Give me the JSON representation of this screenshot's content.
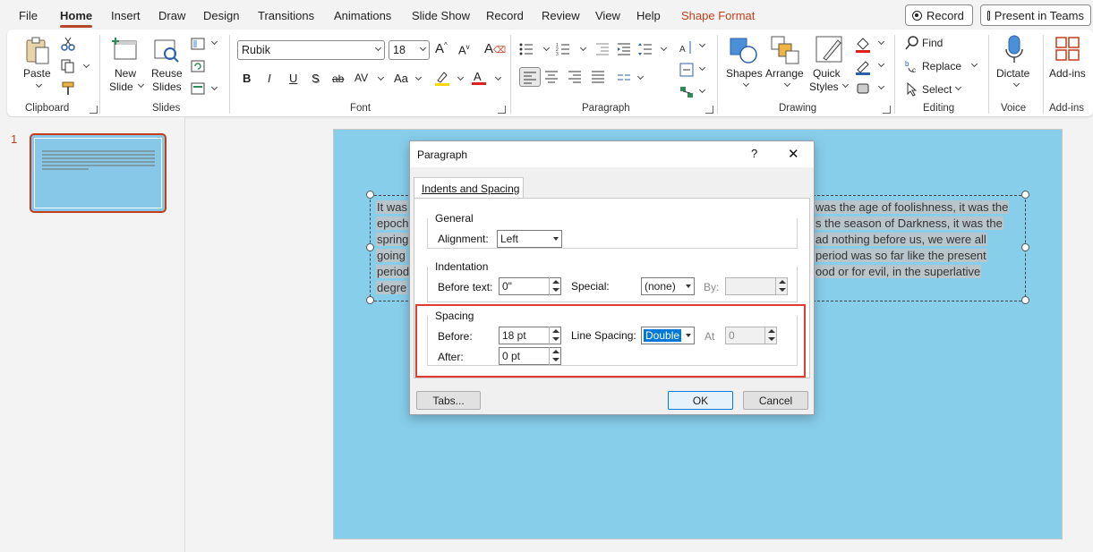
{
  "menu": {
    "items": [
      "File",
      "Home",
      "Insert",
      "Draw",
      "Design",
      "Transitions",
      "Animations",
      "Slide Show",
      "Record",
      "Review",
      "View",
      "Help",
      "Shape Format"
    ],
    "record_button": "Record",
    "present_button": "Present in Teams"
  },
  "ribbon": {
    "clipboard": {
      "paste": "Paste",
      "label": "Clipboard"
    },
    "slides": {
      "new_slide_line1": "New",
      "new_slide_line2": "Slide",
      "reuse_line1": "Reuse",
      "reuse_line2": "Slides",
      "label": "Slides"
    },
    "font": {
      "name": "Rubik",
      "size": "18",
      "bold": "B",
      "italic": "I",
      "underline": "U",
      "shadow": "S",
      "strike": "ab",
      "spacing": "AV",
      "case": "Aa",
      "label": "Font"
    },
    "paragraph": {
      "label": "Paragraph"
    },
    "drawing": {
      "shapes": "Shapes",
      "arrange": "Arrange",
      "quick_line1": "Quick",
      "quick_line2": "Styles",
      "label": "Drawing"
    },
    "editing": {
      "find": "Find",
      "replace": "Replace",
      "select": "Select",
      "label": "Editing"
    },
    "voice": {
      "dictate": "Dictate",
      "label": "Voice"
    },
    "addins": {
      "addins": "Add-ins",
      "label": "Add-ins"
    }
  },
  "thumbnail": {
    "number": "1"
  },
  "slide": {
    "left_lines": [
      "It was",
      "epoch",
      "spring",
      "going",
      "period",
      "degre"
    ],
    "right_lines": [
      "was the age of foolishness, it was the",
      "s the season of Darkness, it was the",
      "ad nothing before us, we were all",
      "period was so far like the present",
      "ood or for evil, in the superlative"
    ]
  },
  "dialog": {
    "title": "Paragraph",
    "help": "?",
    "close": "✕",
    "tab": "Indents and Spacing",
    "general": {
      "legend": "General",
      "alignment_label": "Alignment:",
      "alignment_value": "Left"
    },
    "indentation": {
      "legend": "Indentation",
      "before_text_label": "Before text:",
      "before_text_value": "0\"",
      "special_label": "Special:",
      "special_value": "(none)",
      "by_label": "By:",
      "by_value": ""
    },
    "spacing": {
      "legend": "Spacing",
      "before_label": "Before:",
      "before_value": "18 pt",
      "after_label": "After:",
      "after_value": "0 pt",
      "line_spacing_label": "Line Spacing:",
      "line_spacing_value": "Double",
      "at_label": "At",
      "at_value": "0"
    },
    "tabs_button": "Tabs...",
    "ok_button": "OK",
    "cancel_button": "Cancel"
  },
  "colors": {
    "accent": "#b7472a",
    "shape_format": "#c43e1c",
    "slide_bg": "#87ceeb",
    "highlight": "#e03c31",
    "selection": "#0078d7"
  }
}
